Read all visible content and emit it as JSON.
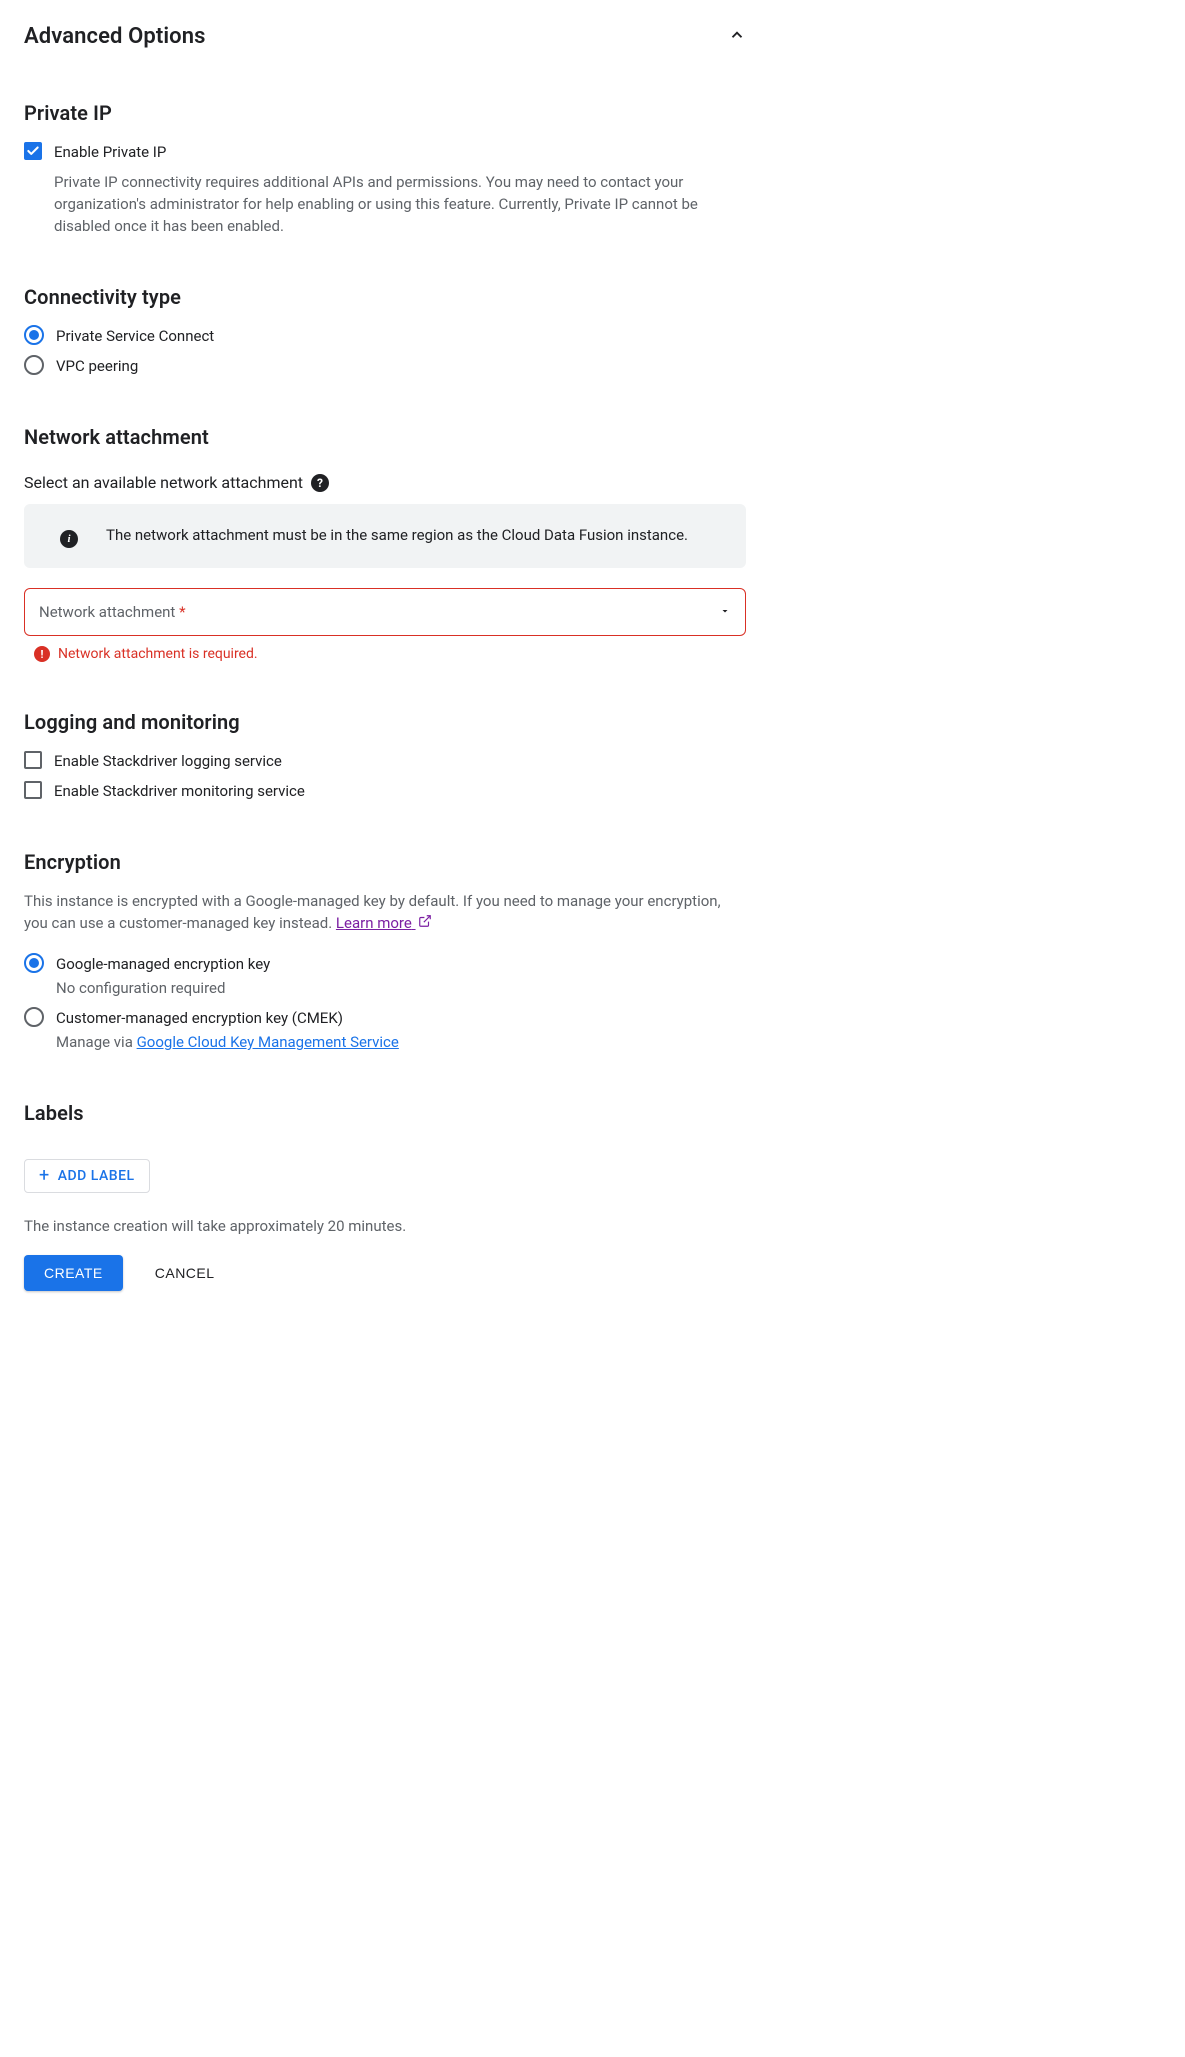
{
  "header": {
    "title": "Advanced Options"
  },
  "privateIp": {
    "heading": "Private IP",
    "enableLabel": "Enable Private IP",
    "helper": "Private IP connectivity requires additional APIs and permissions. You may need to contact your organization's administrator for help enabling or using this feature. Currently, Private IP cannot be disabled once it has been enabled."
  },
  "connectivity": {
    "heading": "Connectivity type",
    "options": {
      "psc": "Private Service Connect",
      "vpc": "VPC peering"
    }
  },
  "networkAttachment": {
    "heading": "Network attachment",
    "subheading": "Select an available network attachment",
    "info": "The network attachment must be in the same region as the Cloud Data Fusion instance.",
    "fieldLabel": "Network attachment",
    "error": "Network attachment is required."
  },
  "logging": {
    "heading": "Logging and monitoring",
    "loggingLabel": "Enable Stackdriver logging service",
    "monitoringLabel": "Enable Stackdriver monitoring service"
  },
  "encryption": {
    "heading": "Encryption",
    "description": "This instance is encrypted with a Google-managed key by default. If you need to manage your encryption, you can use a customer-managed key instead.",
    "learnMore": "Learn more",
    "google": {
      "label": "Google-managed encryption key",
      "helper": "No configuration required"
    },
    "cmek": {
      "label": "Customer-managed encryption key (CMEK)",
      "helperPrefix": "Manage via ",
      "helperLink": "Google Cloud Key Management Service"
    }
  },
  "labels": {
    "heading": "Labels",
    "addButton": "ADD LABEL"
  },
  "footer": {
    "note": "The instance creation will take approximately 20 minutes.",
    "create": "CREATE",
    "cancel": "CANCEL"
  }
}
